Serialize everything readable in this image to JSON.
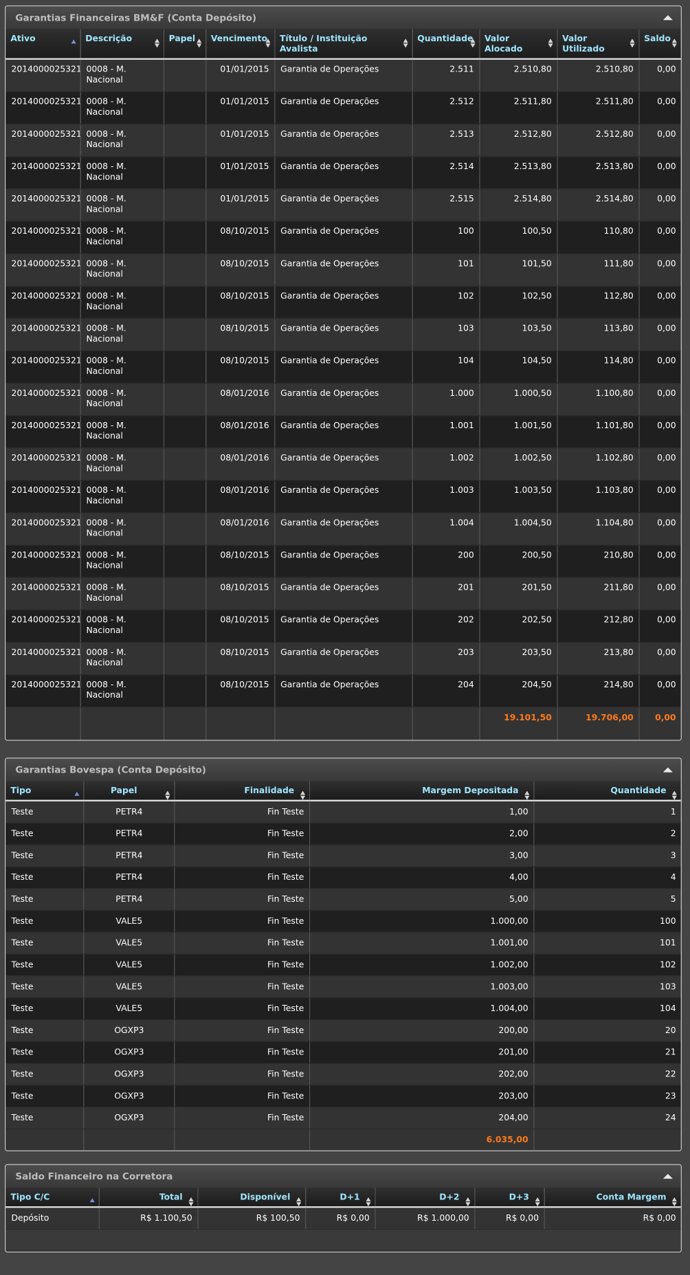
{
  "panels": {
    "bmf": {
      "title": "Garantias Financeiras BM&F (Conta Depósito)",
      "columns": [
        "Ativo",
        "Descrição",
        "Papel",
        "Vencimento",
        "Título / Instituição Avalista",
        "Quantidade",
        "Valor Alocado",
        "Valor Utilizado",
        "Saldo"
      ],
      "rows": [
        [
          "2014000025321",
          "0008 - M. Nacional",
          "",
          "01/01/2015",
          "Garantia de Operações",
          "2.511",
          "2.510,80",
          "2.510,80",
          "0,00"
        ],
        [
          "2014000025321",
          "0008 - M. Nacional",
          "",
          "01/01/2015",
          "Garantia de Operações",
          "2.512",
          "2.511,80",
          "2.511,80",
          "0,00"
        ],
        [
          "2014000025321",
          "0008 - M. Nacional",
          "",
          "01/01/2015",
          "Garantia de Operações",
          "2.513",
          "2.512,80",
          "2.512,80",
          "0,00"
        ],
        [
          "2014000025321",
          "0008 - M. Nacional",
          "",
          "01/01/2015",
          "Garantia de Operações",
          "2.514",
          "2.513,80",
          "2.513,80",
          "0,00"
        ],
        [
          "2014000025321",
          "0008 - M. Nacional",
          "",
          "01/01/2015",
          "Garantia de Operações",
          "2.515",
          "2.514,80",
          "2.514,80",
          "0,00"
        ],
        [
          "2014000025321",
          "0008 - M. Nacional",
          "",
          "08/10/2015",
          "Garantia de Operações",
          "100",
          "100,50",
          "110,80",
          "0,00"
        ],
        [
          "2014000025321",
          "0008 - M. Nacional",
          "",
          "08/10/2015",
          "Garantia de Operações",
          "101",
          "101,50",
          "111,80",
          "0,00"
        ],
        [
          "2014000025321",
          "0008 - M. Nacional",
          "",
          "08/10/2015",
          "Garantia de Operações",
          "102",
          "102,50",
          "112,80",
          "0,00"
        ],
        [
          "2014000025321",
          "0008 - M. Nacional",
          "",
          "08/10/2015",
          "Garantia de Operações",
          "103",
          "103,50",
          "113,80",
          "0,00"
        ],
        [
          "2014000025321",
          "0008 - M. Nacional",
          "",
          "08/10/2015",
          "Garantia de Operações",
          "104",
          "104,50",
          "114,80",
          "0,00"
        ],
        [
          "2014000025321",
          "0008 - M. Nacional",
          "",
          "08/01/2016",
          "Garantia de Operações",
          "1.000",
          "1.000,50",
          "1.100,80",
          "0,00"
        ],
        [
          "2014000025321",
          "0008 - M. Nacional",
          "",
          "08/01/2016",
          "Garantia de Operações",
          "1.001",
          "1.001,50",
          "1.101,80",
          "0,00"
        ],
        [
          "2014000025321",
          "0008 - M. Nacional",
          "",
          "08/01/2016",
          "Garantia de Operações",
          "1.002",
          "1.002,50",
          "1.102,80",
          "0,00"
        ],
        [
          "2014000025321",
          "0008 - M. Nacional",
          "",
          "08/01/2016",
          "Garantia de Operações",
          "1.003",
          "1.003,50",
          "1.103,80",
          "0,00"
        ],
        [
          "2014000025321",
          "0008 - M. Nacional",
          "",
          "08/01/2016",
          "Garantia de Operações",
          "1.004",
          "1.004,50",
          "1.104,80",
          "0,00"
        ],
        [
          "2014000025321",
          "0008 - M. Nacional",
          "",
          "08/10/2015",
          "Garantia de Operações",
          "200",
          "200,50",
          "210,80",
          "0,00"
        ],
        [
          "2014000025321",
          "0008 - M. Nacional",
          "",
          "08/10/2015",
          "Garantia de Operações",
          "201",
          "201,50",
          "211,80",
          "0,00"
        ],
        [
          "2014000025321",
          "0008 - M. Nacional",
          "",
          "08/10/2015",
          "Garantia de Operações",
          "202",
          "202,50",
          "212,80",
          "0,00"
        ],
        [
          "2014000025321",
          "0008 - M. Nacional",
          "",
          "08/10/2015",
          "Garantia de Operações",
          "203",
          "203,50",
          "213,80",
          "0,00"
        ],
        [
          "2014000025321",
          "0008 - M. Nacional",
          "",
          "08/10/2015",
          "Garantia de Operações",
          "204",
          "204,50",
          "214,80",
          "0,00"
        ]
      ],
      "totals": [
        "",
        "",
        "",
        "",
        "",
        "",
        "19.101,50",
        "19.706,00",
        "0,00"
      ]
    },
    "bovespa": {
      "title": "Garantias Bovespa (Conta Depósito)",
      "columns": [
        "Tipo",
        "Papel",
        "Finalidade",
        "Margem Depositada",
        "Quantidade"
      ],
      "rows": [
        [
          "Teste",
          "PETR4",
          "Fin Teste",
          "1,00",
          "1"
        ],
        [
          "Teste",
          "PETR4",
          "Fin Teste",
          "2,00",
          "2"
        ],
        [
          "Teste",
          "PETR4",
          "Fin Teste",
          "3,00",
          "3"
        ],
        [
          "Teste",
          "PETR4",
          "Fin Teste",
          "4,00",
          "4"
        ],
        [
          "Teste",
          "PETR4",
          "Fin Teste",
          "5,00",
          "5"
        ],
        [
          "Teste",
          "VALE5",
          "Fin Teste",
          "1.000,00",
          "100"
        ],
        [
          "Teste",
          "VALE5",
          "Fin Teste",
          "1.001,00",
          "101"
        ],
        [
          "Teste",
          "VALE5",
          "Fin Teste",
          "1.002,00",
          "102"
        ],
        [
          "Teste",
          "VALE5",
          "Fin Teste",
          "1.003,00",
          "103"
        ],
        [
          "Teste",
          "VALE5",
          "Fin Teste",
          "1.004,00",
          "104"
        ],
        [
          "Teste",
          "OGXP3",
          "Fin Teste",
          "200,00",
          "20"
        ],
        [
          "Teste",
          "OGXP3",
          "Fin Teste",
          "201,00",
          "21"
        ],
        [
          "Teste",
          "OGXP3",
          "Fin Teste",
          "202,00",
          "22"
        ],
        [
          "Teste",
          "OGXP3",
          "Fin Teste",
          "203,00",
          "23"
        ],
        [
          "Teste",
          "OGXP3",
          "Fin Teste",
          "204,00",
          "24"
        ]
      ],
      "totals": [
        "",
        "",
        "",
        "6.035,00",
        ""
      ]
    },
    "saldo": {
      "title": "Saldo Financeiro na Corretora",
      "columns": [
        "Tipo C/C",
        "Total",
        "Disponível",
        "D+1",
        "D+2",
        "D+3",
        "Conta Margem"
      ],
      "rows": [
        [
          "Depósito",
          "R$ 1.100,50",
          "R$ 100,50",
          "R$ 0,00",
          "R$ 1.000,00",
          "R$ 0,00",
          "R$ 0,00"
        ]
      ]
    }
  },
  "colors": {
    "header_text": "#9fe6ff",
    "total_text": "#ff7a1a",
    "panel_title": "#bdbdbd"
  },
  "icons": {
    "collapse": "chevron-up-icon",
    "sort": "sort-arrows-icon",
    "sort_asc": "sort-asc-icon"
  }
}
